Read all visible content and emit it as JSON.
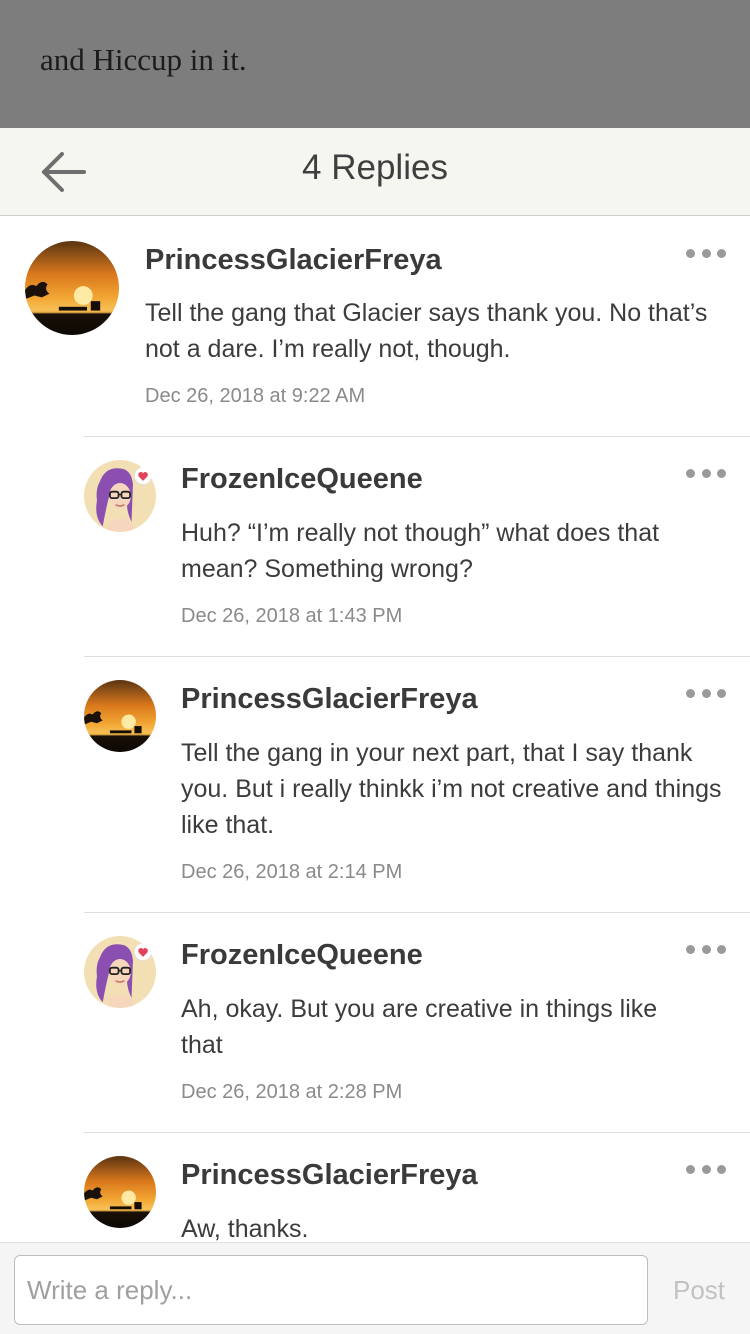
{
  "story_excerpt": "and Hiccup in it.",
  "header": {
    "back_icon": "arrow-left-icon",
    "title": "4 Replies"
  },
  "colors": {
    "header_bg": "#f6f6f1",
    "overlay_bg": "#7d7d7d",
    "meta_text": "#8a8a8a"
  },
  "replies": [
    {
      "author": "PrincessGlacierFreya",
      "text": "Tell the gang that Glacier says thank you. No that’s not a dare. I’m really not, though.",
      "timestamp": "Dec 26, 2018 at 9:22 AM",
      "avatar": "sunset-avatar",
      "more_icon": "more-dots-icon",
      "nested": false
    },
    {
      "author": "FrozenIceQueene",
      "text": "Huh? “I’m really not though” what does that mean? Something wrong?",
      "timestamp": "Dec 26, 2018 at 1:43 PM",
      "avatar": "purple-hair-girl-avatar",
      "more_icon": "more-dots-icon",
      "nested": true
    },
    {
      "author": "PrincessGlacierFreya",
      "text": "Tell the gang in your next part, that I say thank you. But i really thinkk i’m not creative and things like that.",
      "timestamp": "Dec 26, 2018 at 2:14 PM",
      "avatar": "sunset-avatar",
      "more_icon": "more-dots-icon",
      "nested": true
    },
    {
      "author": "FrozenIceQueene",
      "text": "Ah, okay. But you are creative in things like that",
      "timestamp": "Dec 26, 2018 at 2:28 PM",
      "avatar": "purple-hair-girl-avatar",
      "more_icon": "more-dots-icon",
      "nested": true
    },
    {
      "author": "PrincessGlacierFreya",
      "text": "Aw, thanks.",
      "avatar": "sunset-avatar",
      "more_icon": "more-dots-icon",
      "nested": true
    }
  ],
  "composer": {
    "placeholder": "Write a reply...",
    "value": "",
    "post_label": "Post"
  }
}
